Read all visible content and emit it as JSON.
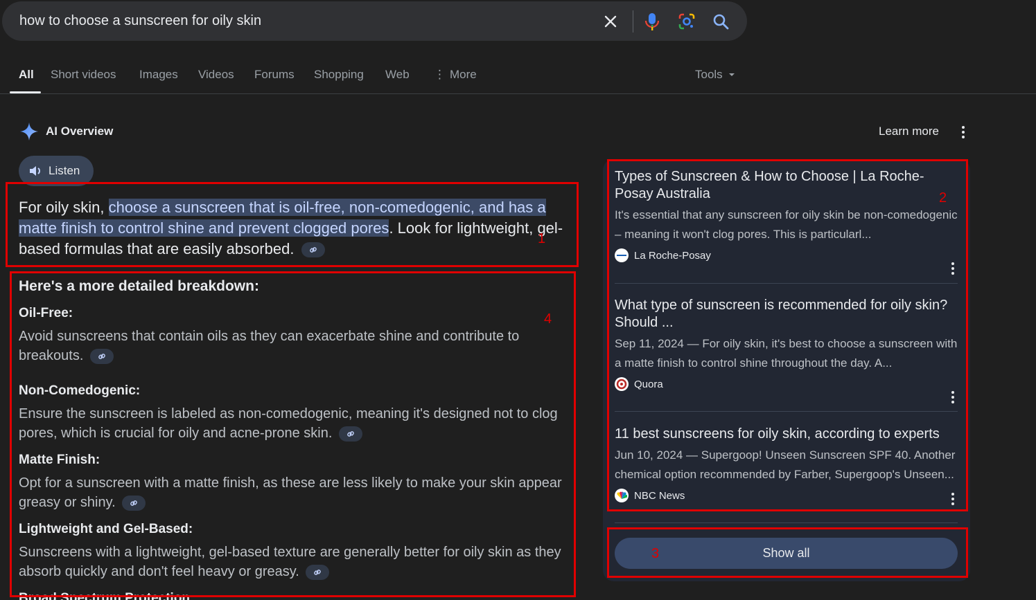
{
  "search": {
    "query": "how to choose a sunscreen for oily skin"
  },
  "icons": {
    "clear": "close-icon",
    "voice": "microphone-icon",
    "lens": "lens-camera-icon",
    "search": "search-icon"
  },
  "tabs": [
    {
      "label": "All"
    },
    {
      "label": "Short videos"
    },
    {
      "label": "Images"
    },
    {
      "label": "Videos"
    },
    {
      "label": "Forums"
    },
    {
      "label": "Shopping"
    },
    {
      "label": "Web"
    },
    {
      "label": "More"
    }
  ],
  "tools_label": "Tools",
  "ai_overview": {
    "title": "AI Overview",
    "learn_more": "Learn more",
    "listen": "Listen",
    "intro_prefix": "For oily skin, ",
    "intro_highlight": "choose a sunscreen that is oil-free, non-comedogenic, and has a matte finish to control shine and prevent clogged pores",
    "intro_suffix": ". Look for lightweight, gel-based formulas that are easily absorbed.",
    "breakdown_heading": "Here's a more detailed breakdown:",
    "items": [
      {
        "title": "Oil-Free:",
        "text": "Avoid sunscreens that contain oils as they can exacerbate shine and contribute to breakouts."
      },
      {
        "title": "Non-Comedogenic:",
        "text": "Ensure the sunscreen is labeled as non-comedogenic, meaning it's designed not to clog pores, which is crucial for oily and acne-prone skin."
      },
      {
        "title": "Matte Finish:",
        "text": "Opt for a sunscreen with a matte finish, as these are less likely to make your skin appear greasy or shiny."
      },
      {
        "title": "Lightweight and Gel-Based:",
        "text": "Sunscreens with a lightweight, gel-based texture are generally better for oily skin as they absorb quickly and don't feel heavy or greasy."
      },
      {
        "title": "Broad Spectrum Protection:",
        "text": ""
      }
    ]
  },
  "sources": [
    {
      "title": "Types of Sunscreen & How to Choose | La Roche-Posay Australia",
      "snippet": "It's essential that any sunscreen for oily skin be non-comedogenic – meaning it won't clog pores. This is particularl...",
      "site": "La Roche-Posay"
    },
    {
      "title": "What type of sunscreen is recommended for oily skin? Should ...",
      "snippet": "Sep 11, 2024 — For oily skin, it's best to choose a sunscreen with a matte finish to control shine throughout the day. A...",
      "site": "Quora"
    },
    {
      "title": "11 best sunscreens for oily skin, according to experts",
      "snippet": "Jun 10, 2024 — Supergoop! Unseen Sunscreen SPF 40. Another chemical option recommended by Farber, Supergoop's Unseen...",
      "site": "NBC News"
    }
  ],
  "show_all": "Show all",
  "annotations": [
    "1",
    "2",
    "3",
    "4"
  ],
  "colors": {
    "background": "#1f1f1f",
    "highlight": "#3c4a66",
    "annotation": "#e00000",
    "show_all_bg": "#394a6b"
  }
}
